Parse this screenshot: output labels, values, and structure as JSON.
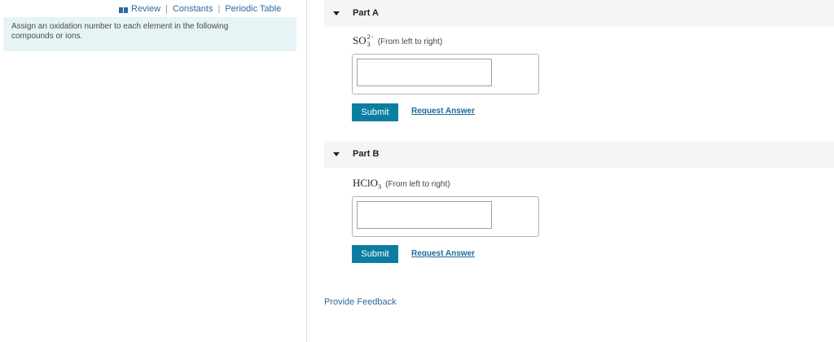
{
  "left": {
    "links": {
      "review": "Review",
      "constants": "Constants",
      "periodic_table": "Periodic Table",
      "separator": "|"
    },
    "instructions": "Assign an oxidation number to each element in the following compounds or ions."
  },
  "parts": [
    {
      "title": "Part A",
      "formula": {
        "base": "SO",
        "sup": "2−",
        "sub": "3"
      },
      "hint": "(From left to right)",
      "input_value": "",
      "submit_label": "Submit",
      "request_label": "Request Answer"
    },
    {
      "title": "Part B",
      "formula": {
        "base": "HClO",
        "sub": "3"
      },
      "hint": "(From left to right)",
      "input_value": "",
      "submit_label": "Submit",
      "request_label": "Request Answer"
    }
  ],
  "feedback_label": "Provide Feedback",
  "colors": {
    "accent": "#0b7ea0",
    "link": "#2c6aa0",
    "intro_bg": "#e6f4f6",
    "part_header_bg": "#f5f5f5"
  },
  "icons": {
    "review": "book-icon",
    "collapse": "caret-down-icon"
  }
}
